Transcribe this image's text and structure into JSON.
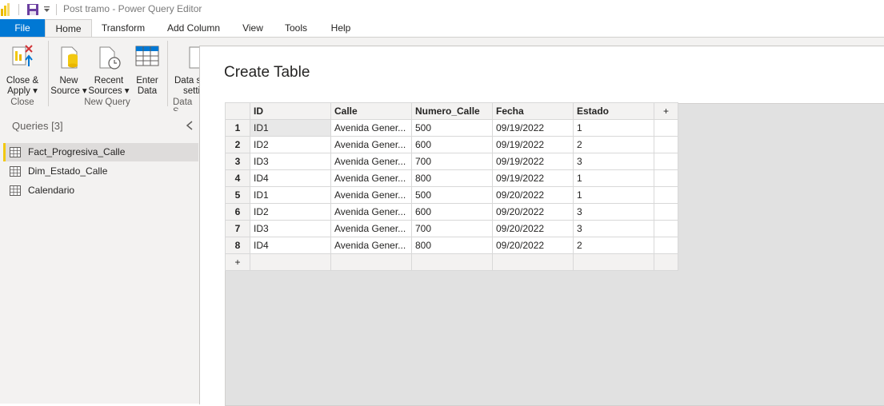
{
  "window": {
    "title": "Post tramo - Power Query Editor"
  },
  "tabs": [
    {
      "label": "File"
    },
    {
      "label": "Home"
    },
    {
      "label": "Transform"
    },
    {
      "label": "Add Column"
    },
    {
      "label": "View"
    },
    {
      "label": "Tools"
    },
    {
      "label": "Help"
    }
  ],
  "ribbon": {
    "close_apply": {
      "line1": "Close &",
      "line2": "Apply ▾"
    },
    "new_source": {
      "line1": "New",
      "line2": "Source ▾"
    },
    "recent_sources": {
      "line1": "Recent",
      "line2": "Sources ▾"
    },
    "enter_data": {
      "line1": "Enter",
      "line2": "Data"
    },
    "data_source": {
      "line1": "Data s",
      "line2": "setti"
    },
    "groups": {
      "close": "Close",
      "new_query": "New Query",
      "data_sources": "Data S"
    }
  },
  "queries": {
    "header": "Queries [3]",
    "items": [
      "Fact_Progresiva_Calle",
      "Dim_Estado_Calle",
      "Calendario"
    ]
  },
  "dialog": {
    "title": "Create Table",
    "columns": [
      "ID",
      "Calle",
      "Numero_Calle",
      "Fecha",
      "Estado"
    ],
    "add_column": "+",
    "add_row": "+",
    "rows": [
      {
        "n": "1",
        "cells": [
          "ID1",
          "Avenida Gener...",
          "500",
          "09/19/2022",
          "1"
        ]
      },
      {
        "n": "2",
        "cells": [
          "ID2",
          "Avenida Gener...",
          "600",
          "09/19/2022",
          "2"
        ]
      },
      {
        "n": "3",
        "cells": [
          "ID3",
          "Avenida Gener...",
          "700",
          "09/19/2022",
          "3"
        ]
      },
      {
        "n": "4",
        "cells": [
          "ID4",
          "Avenida Gener...",
          "800",
          "09/19/2022",
          "1"
        ]
      },
      {
        "n": "5",
        "cells": [
          "ID1",
          "Avenida Gener...",
          "500",
          "09/20/2022",
          "1"
        ]
      },
      {
        "n": "6",
        "cells": [
          "ID2",
          "Avenida Gener...",
          "600",
          "09/20/2022",
          "3"
        ]
      },
      {
        "n": "7",
        "cells": [
          "ID3",
          "Avenida Gener...",
          "700",
          "09/20/2022",
          "3"
        ]
      },
      {
        "n": "8",
        "cells": [
          "ID4",
          "Avenida Gener...",
          "800",
          "09/20/2022",
          "2"
        ]
      }
    ]
  },
  "colors": {
    "accent": "#0078d4",
    "ribbon_bg": "#f3f2f1",
    "selection_bar": "#f2c811"
  }
}
